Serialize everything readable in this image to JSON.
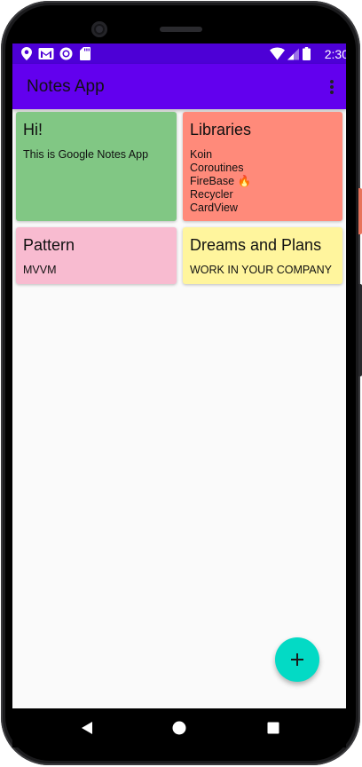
{
  "statusbar": {
    "time": "2:30",
    "icons": [
      "location-icon",
      "gmail-icon",
      "sync-icon",
      "sd-card-icon",
      "wifi-icon",
      "signal-icon",
      "battery-icon"
    ]
  },
  "appbar": {
    "title": "Notes App",
    "menu_icon": "more-vert-icon"
  },
  "notes": [
    {
      "title": "Hi!",
      "lines": [
        "This is Google Notes App"
      ],
      "color": "#81c784"
    },
    {
      "title": "Libraries",
      "lines": [
        "Koin",
        "Coroutines",
        "FireBase 🔥",
        "Recycler",
        "CardView"
      ],
      "color": "#ff8a7a"
    },
    {
      "title": "Pattern",
      "lines": [
        "MVVM"
      ],
      "color": "#f8bbd0"
    },
    {
      "title": "Dreams and Plans",
      "lines": [
        "WORK IN YOUR COMPANY"
      ],
      "color": "#fff59d"
    }
  ],
  "fab": {
    "icon": "plus-icon",
    "color": "#03dac5"
  },
  "navbar": {
    "icons": [
      "back-icon",
      "home-icon",
      "recents-icon"
    ]
  },
  "colors": {
    "primary": "#6200ee",
    "primary_dark": "#4d00d6",
    "accent": "#03dac5",
    "background": "#fafafa"
  }
}
